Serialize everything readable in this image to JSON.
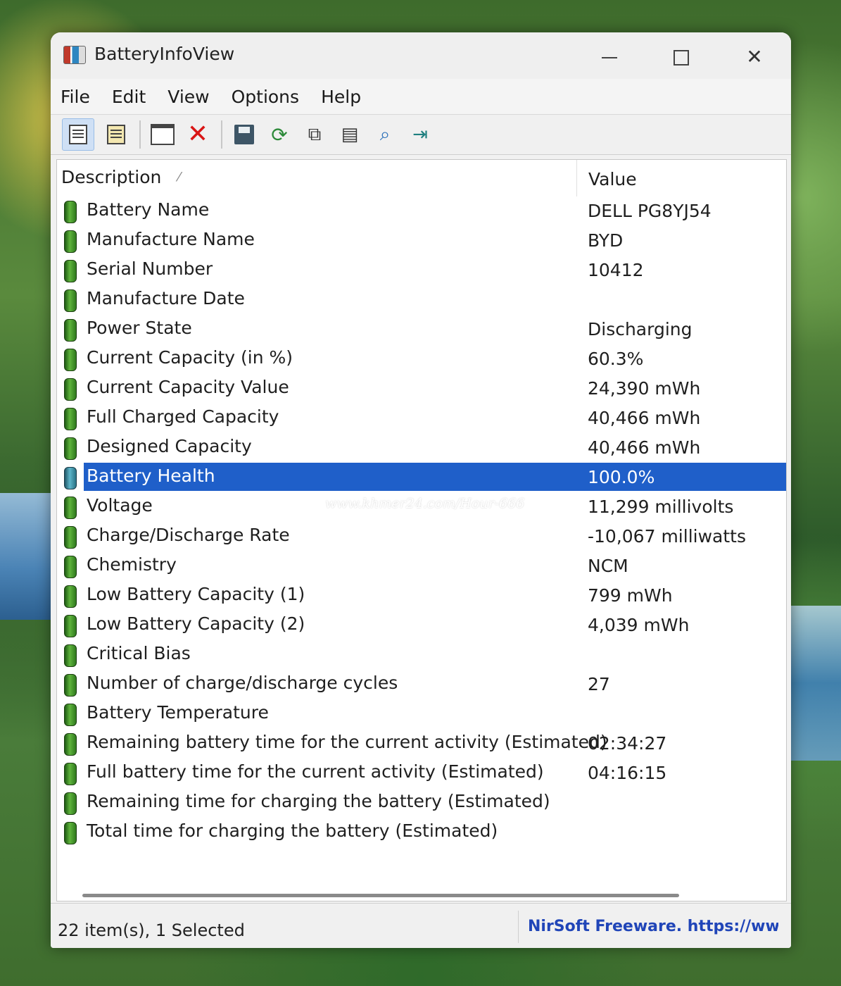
{
  "window": {
    "title": "BatteryInfoView"
  },
  "menu": [
    "File",
    "Edit",
    "View",
    "Options",
    "Help"
  ],
  "toolbar": {
    "icons": [
      "html-report-icon",
      "clipboard-icon",
      "window-icon",
      "delete-icon",
      "save-icon",
      "refresh-icon",
      "copy-icon",
      "properties-icon",
      "find-icon",
      "exit-icon"
    ]
  },
  "columns": {
    "description": "Description",
    "value": "Value"
  },
  "rows": [
    {
      "description": "Battery Name",
      "value": "DELL PG8YJ54"
    },
    {
      "description": "Manufacture Name",
      "value": "BYD"
    },
    {
      "description": "Serial Number",
      "value": "10412"
    },
    {
      "description": "Manufacture Date",
      "value": ""
    },
    {
      "description": "Power State",
      "value": "Discharging"
    },
    {
      "description": "Current Capacity (in %)",
      "value": "60.3%"
    },
    {
      "description": "Current Capacity Value",
      "value": "24,390 mWh"
    },
    {
      "description": "Full Charged Capacity",
      "value": "40,466 mWh"
    },
    {
      "description": "Designed Capacity",
      "value": "40,466 mWh"
    },
    {
      "description": "Battery Health",
      "value": "100.0%",
      "selected": true
    },
    {
      "description": "Voltage",
      "value": "11,299 millivolts"
    },
    {
      "description": "Charge/Discharge Rate",
      "value": "-10,067 milliwatts"
    },
    {
      "description": "Chemistry",
      "value": "NCM"
    },
    {
      "description": "Low Battery Capacity (1)",
      "value": "799 mWh"
    },
    {
      "description": "Low Battery Capacity (2)",
      "value": "4,039 mWh"
    },
    {
      "description": "Critical Bias",
      "value": ""
    },
    {
      "description": "Number of charge/discharge cycles",
      "value": "27"
    },
    {
      "description": "Battery Temperature",
      "value": ""
    },
    {
      "description": "Remaining battery time for the current activity (Estimated)",
      "value": "02:34:27"
    },
    {
      "description": "Full battery time for the current activity (Estimated)",
      "value": "04:16:15"
    },
    {
      "description": "Remaining time for charging the battery (Estimated)",
      "value": ""
    },
    {
      "description": "Total  time for charging the battery (Estimated)",
      "value": ""
    }
  ],
  "watermark": "www.khmer24.com/Hour-666",
  "status": {
    "items": "22 item(s), 1 Selected",
    "link": "NirSoft Freeware. https://www.nirsoft.net"
  },
  "colors": {
    "selection": "#1f5fc9",
    "link": "#2045b8",
    "delete": "#d91515"
  }
}
